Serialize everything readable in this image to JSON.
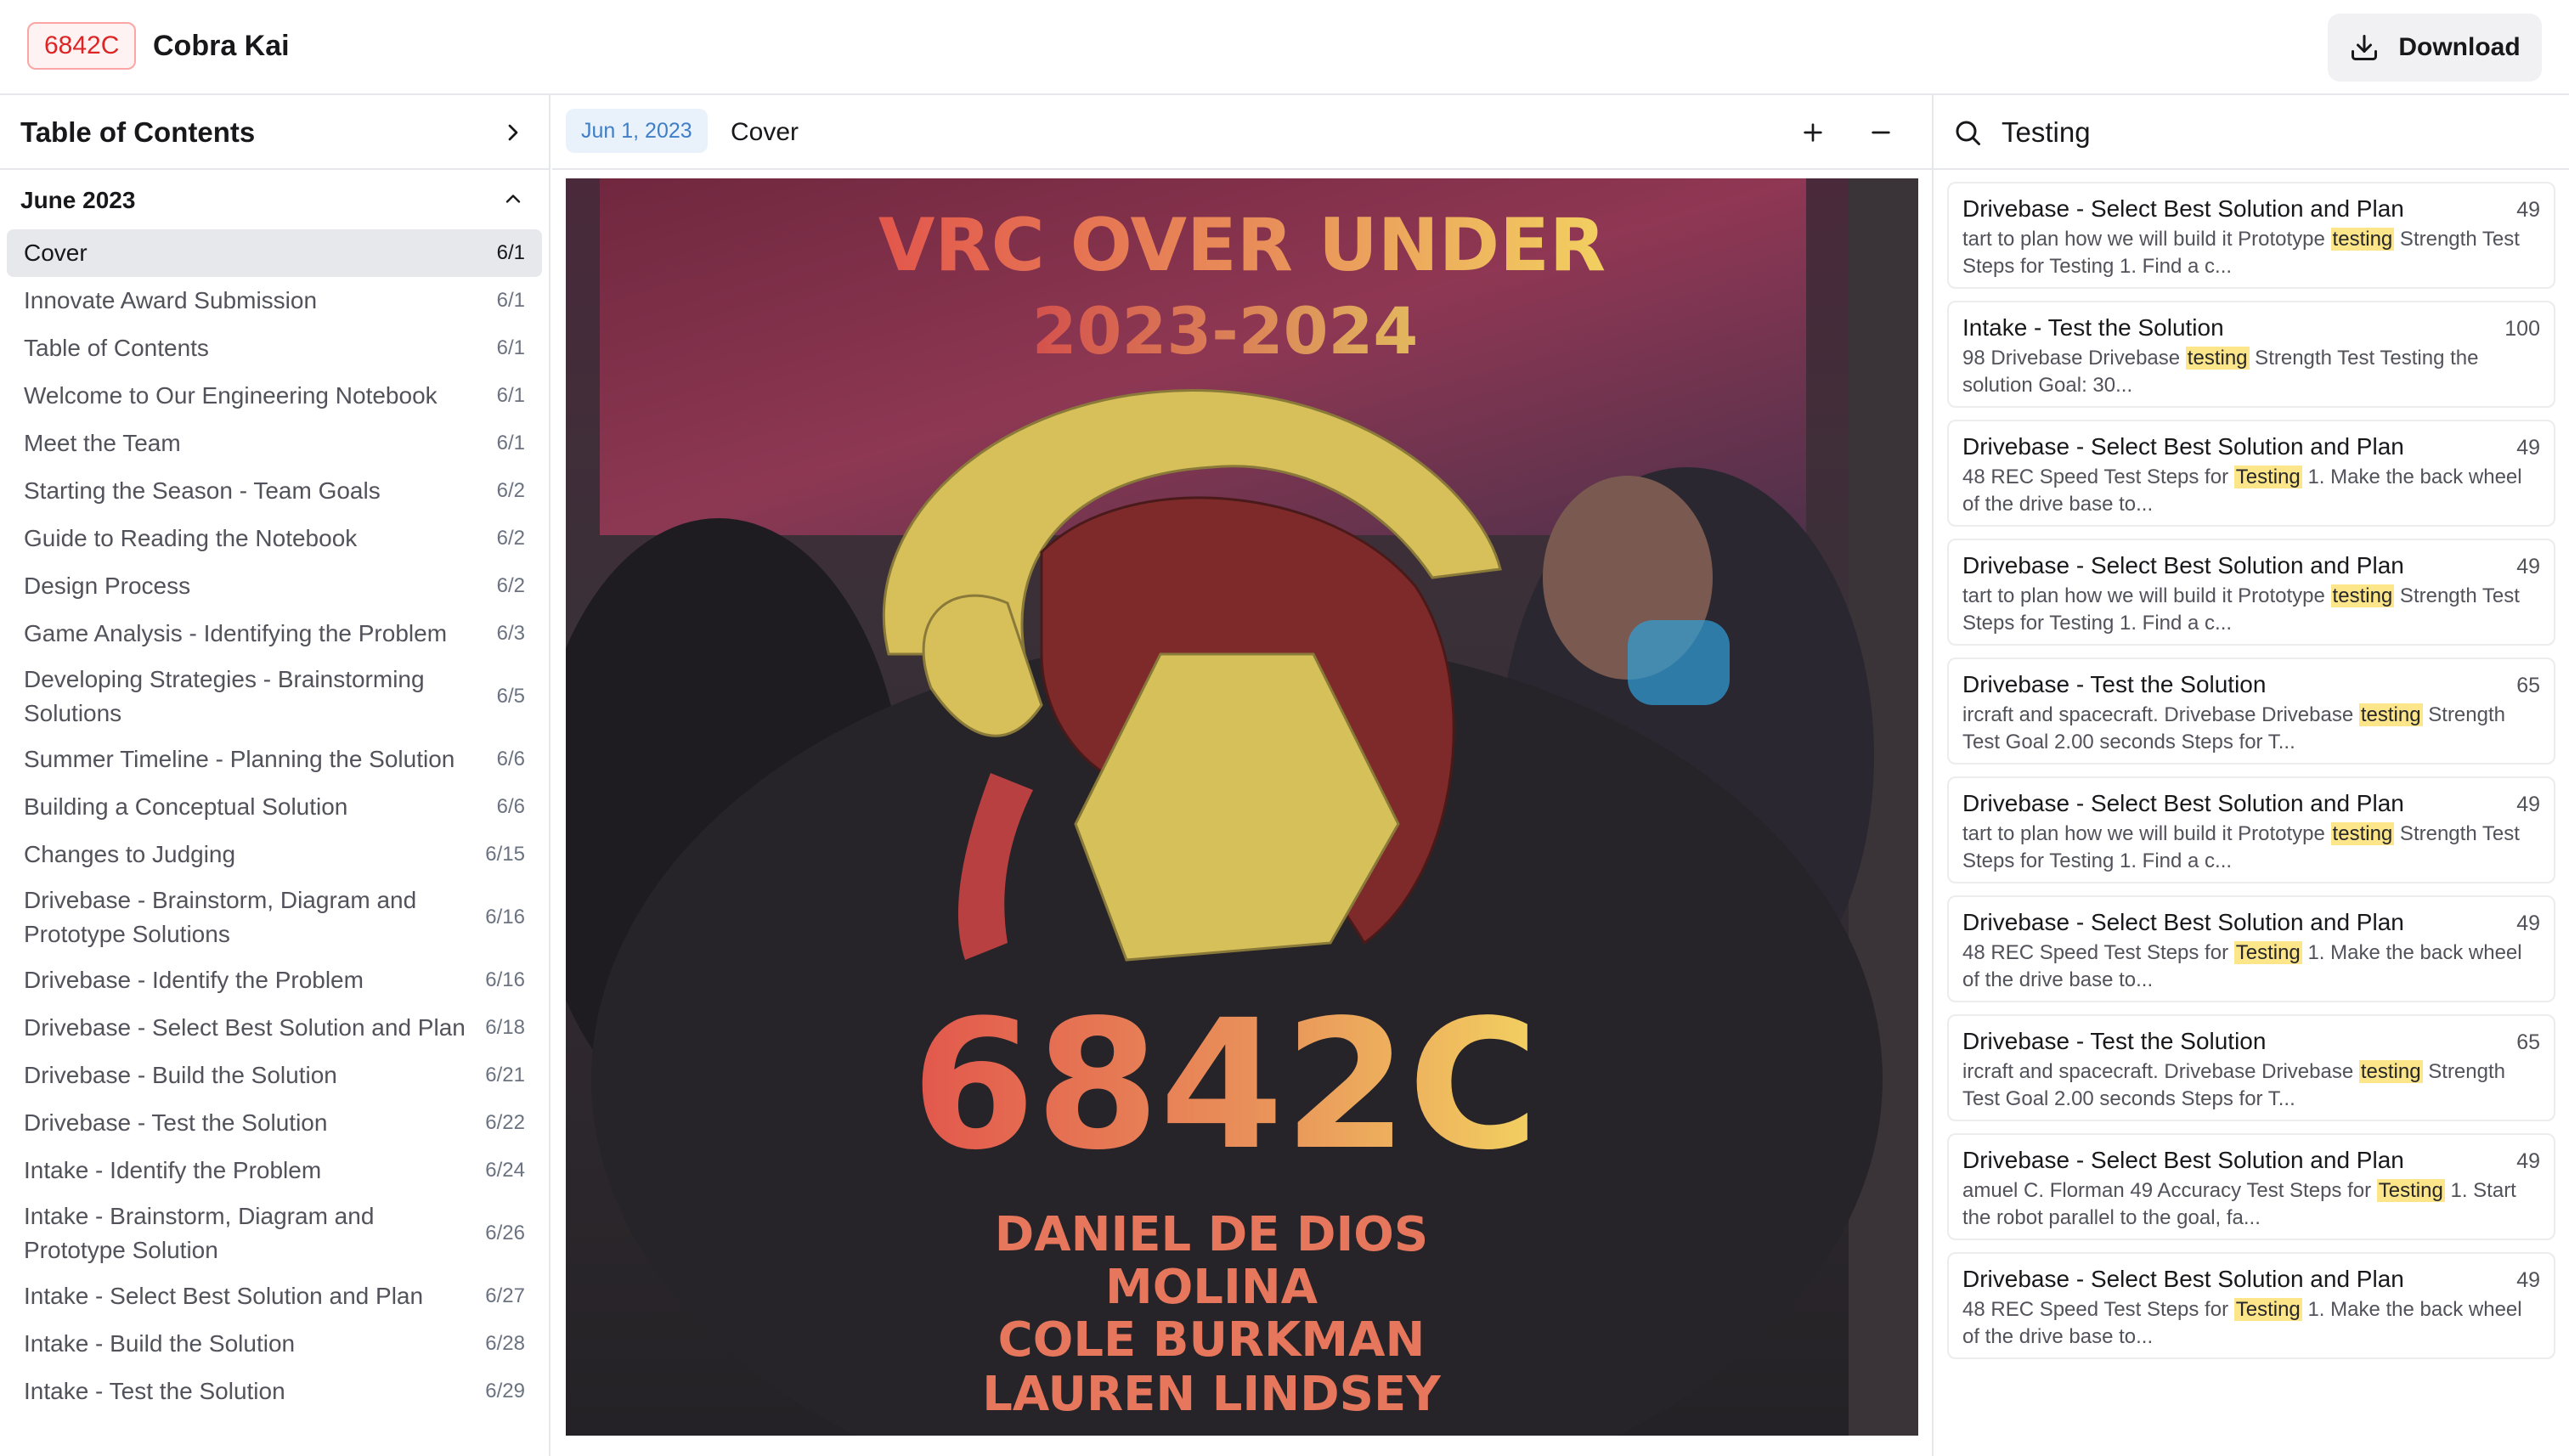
{
  "header": {
    "team_number": "6842C",
    "team_name": "Cobra Kai",
    "download_label": "Download"
  },
  "sidebar": {
    "title": "Table of Contents",
    "month": "June 2023",
    "items": [
      {
        "label": "Cover",
        "date": "6/1",
        "active": true
      },
      {
        "label": "Innovate Award Submission",
        "date": "6/1"
      },
      {
        "label": "Table of Contents",
        "date": "6/1"
      },
      {
        "label": "Welcome to Our Engineering Notebook",
        "date": "6/1"
      },
      {
        "label": "Meet the Team",
        "date": "6/1"
      },
      {
        "label": "Starting the Season - Team Goals",
        "date": "6/2"
      },
      {
        "label": "Guide to Reading the Notebook",
        "date": "6/2"
      },
      {
        "label": "Design Process",
        "date": "6/2"
      },
      {
        "label": "Game Analysis - Identifying the Problem",
        "date": "6/3"
      },
      {
        "label": "Developing Strategies - Brainstorming Solutions",
        "date": "6/5"
      },
      {
        "label": "Summer Timeline - Planning the Solution",
        "date": "6/6"
      },
      {
        "label": "Building a Conceptual Solution",
        "date": "6/6"
      },
      {
        "label": "Changes to Judging",
        "date": "6/15"
      },
      {
        "label": "Drivebase - Brainstorm, Diagram and Prototype Solutions",
        "date": "6/16"
      },
      {
        "label": "Drivebase - Identify the Problem",
        "date": "6/16"
      },
      {
        "label": "Drivebase - Select Best Solution and Plan",
        "date": "6/18"
      },
      {
        "label": "Drivebase - Build the Solution",
        "date": "6/21"
      },
      {
        "label": "Drivebase - Test the Solution",
        "date": "6/22"
      },
      {
        "label": "Intake - Identify the Problem",
        "date": "6/24"
      },
      {
        "label": "Intake - Brainstorm, Diagram and Prototype Solution",
        "date": "6/26"
      },
      {
        "label": "Intake - Select Best Solution and Plan",
        "date": "6/27"
      },
      {
        "label": "Intake - Build the Solution",
        "date": "6/28"
      },
      {
        "label": "Intake - Test the Solution",
        "date": "6/29"
      }
    ]
  },
  "viewer": {
    "date": "Jun 1, 2023",
    "title": "Cover",
    "cover": {
      "heading_line1": "VRC OVER UNDER",
      "heading_line2": "2023-2024",
      "team_number": "6842C",
      "names": [
        "DANIEL DE DIOS",
        "MOLINA",
        "COLE BURKMAN",
        "LAUREN LINDSEY"
      ]
    }
  },
  "search": {
    "query": "Testing",
    "results": [
      {
        "title": "Drivebase - Select Best Solution and Plan",
        "page": "49",
        "pre": "tart to plan how we will build it Prototype ",
        "hit": "testing",
        "post": " Strength Test Steps for Testing 1. Find a c..."
      },
      {
        "title": "Intake - Test the Solution",
        "page": "100",
        "pre": "98 Drivebase Drivebase ",
        "hit": "testing",
        "post": " Strength Test Testing the solution Goal: 30..."
      },
      {
        "title": "Drivebase - Select Best Solution and Plan",
        "page": "49",
        "pre": "48 REC Speed Test Steps for ",
        "hit": "Testing",
        "post": " 1. Make the back wheel of the drive base to..."
      },
      {
        "title": "Drivebase - Select Best Solution and Plan",
        "page": "49",
        "pre": "tart to plan how we will build it Prototype ",
        "hit": "testing",
        "post": " Strength Test Steps for Testing 1. Find a c..."
      },
      {
        "title": "Drivebase - Test the Solution",
        "page": "65",
        "pre": "ircraft and spacecraft. Drivebase Drivebase ",
        "hit": "testing",
        "post": " Strength Test Goal 2.00 seconds Steps for T..."
      },
      {
        "title": "Drivebase - Select Best Solution and Plan",
        "page": "49",
        "pre": "tart to plan how we will build it Prototype ",
        "hit": "testing",
        "post": " Strength Test Steps for Testing 1. Find a c..."
      },
      {
        "title": "Drivebase - Select Best Solution and Plan",
        "page": "49",
        "pre": "48 REC Speed Test Steps for ",
        "hit": "Testing",
        "post": " 1. Make the back wheel of the drive base to..."
      },
      {
        "title": "Drivebase - Test the Solution",
        "page": "65",
        "pre": "ircraft and spacecraft. Drivebase Drivebase ",
        "hit": "testing",
        "post": " Strength Test Goal 2.00 seconds Steps for T..."
      },
      {
        "title": "Drivebase - Select Best Solution and Plan",
        "page": "49",
        "pre": "amuel C. Florman 49 Accuracy Test Steps for ",
        "hit": "Testing",
        "post": " 1. Start the robot parallel to the goal, fa..."
      },
      {
        "title": "Drivebase - Select Best Solution and Plan",
        "page": "49",
        "pre": "48 REC Speed Test Steps for ",
        "hit": "Testing",
        "post": " 1. Make the back wheel of the drive base to..."
      }
    ]
  },
  "colors": {
    "badge_red": "#dc2626",
    "chip_blue": "#3f7fc7",
    "highlight": "#fde68a",
    "active_row": "#e7e8ec"
  }
}
